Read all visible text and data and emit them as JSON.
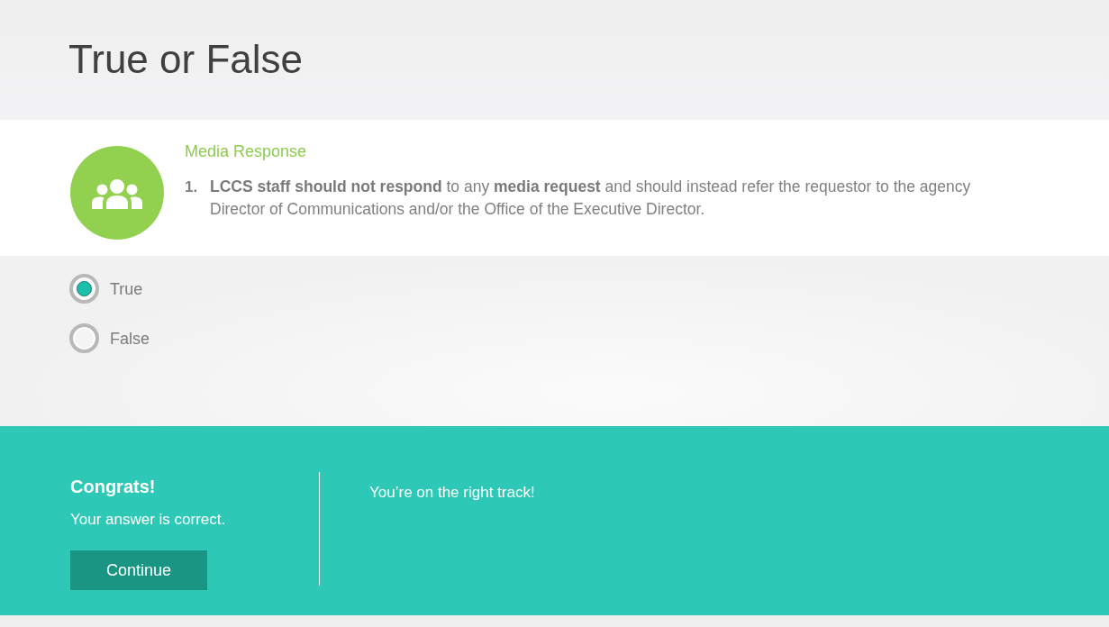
{
  "page": {
    "title": "True or False"
  },
  "question": {
    "heading": "Media Response",
    "number": "1.",
    "text": "**LCCS staff should not respond** to any **media request** and should instead refer the requestor to the agency Director of Communications and/or the Office of the Executive Director."
  },
  "options": [
    {
      "label": "True",
      "selected": true
    },
    {
      "label": "False",
      "selected": false
    }
  ],
  "feedback": {
    "title": "Congrats!",
    "message": "Your answer is correct.",
    "button": "Continue",
    "detail": "You’re on the right track!"
  }
}
